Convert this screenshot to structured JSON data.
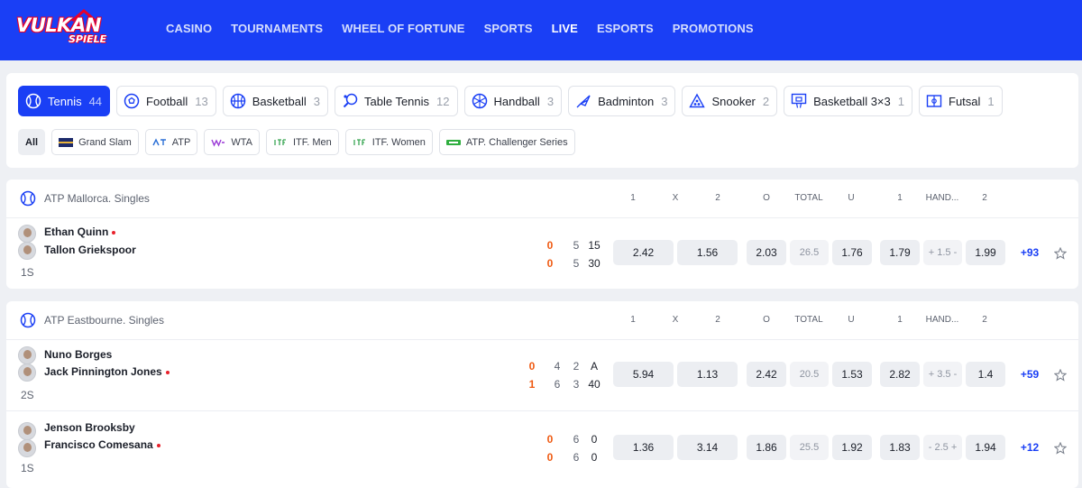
{
  "brand": {
    "logo_main": "VULKAN",
    "logo_sub": "SPIELE"
  },
  "nav": [
    {
      "label": "CASINO"
    },
    {
      "label": "TOURNAMENTS"
    },
    {
      "label": "WHEEL OF FORTUNE"
    },
    {
      "label": "SPORTS"
    },
    {
      "label": "LIVE",
      "active": true
    },
    {
      "label": "ESPORTS"
    },
    {
      "label": "PROMOTIONS"
    }
  ],
  "sports": [
    {
      "label": "Tennis",
      "count": "44",
      "icon": "tennis-ball-icon"
    },
    {
      "label": "Football",
      "count": "13",
      "icon": "football-icon"
    },
    {
      "label": "Basketball",
      "count": "3",
      "icon": "basketball-icon"
    },
    {
      "label": "Table Tennis",
      "count": "12",
      "icon": "table-tennis-icon"
    },
    {
      "label": "Handball",
      "count": "3",
      "icon": "handball-icon"
    },
    {
      "label": "Badminton",
      "count": "3",
      "icon": "shuttlecock-icon"
    },
    {
      "label": "Snooker",
      "count": "2",
      "icon": "snooker-icon"
    },
    {
      "label": "Basketball 3×3",
      "count": "1",
      "icon": "basketball-hoop-icon"
    },
    {
      "label": "Futsal",
      "count": "1",
      "icon": "futsal-icon"
    }
  ],
  "tournaments": [
    {
      "label": "All"
    },
    {
      "label": "Grand Slam",
      "icon": "grand-slam-flag-icon"
    },
    {
      "label": "ATP",
      "icon": "atp-logo-icon"
    },
    {
      "label": "WTA",
      "icon": "wta-logo-icon"
    },
    {
      "label": "ITF. Men",
      "icon": "itf-logo-icon"
    },
    {
      "label": "ITF. Women",
      "icon": "itf-logo-icon"
    },
    {
      "label": "ATP. Challenger Series",
      "icon": "challenger-logo-icon"
    }
  ],
  "columns": {
    "c1": "1",
    "cx": "X",
    "c2": "2",
    "o": "O",
    "total": "TOTAL",
    "u": "U",
    "h1": "1",
    "hand": "HAND...",
    "h2": "2"
  },
  "leagues": [
    {
      "name": "ATP Mallorca. Singles",
      "matches": [
        {
          "player1": "Ethan Quinn",
          "player2": "Tallon Griekspoor",
          "serving": 1,
          "set": "1S",
          "score": {
            "p1": [
              "0",
              "5",
              "15"
            ],
            "p2": [
              "0",
              "5",
              "30"
            ]
          },
          "odds": {
            "w1": "2.42",
            "x": "1.56",
            "o": "2.03",
            "total": "26.5",
            "u": "1.76",
            "h1": "1.79",
            "hand": "+ 1.5 -",
            "h2": "1.99"
          },
          "more": "+93"
        }
      ]
    },
    {
      "name": "ATP Eastbourne. Singles",
      "matches": [
        {
          "player1": "Nuno Borges",
          "player2": "Jack Pinnington Jones",
          "serving": 2,
          "set": "2S",
          "score": {
            "p1": [
              "0",
              "4",
              "2",
              "A"
            ],
            "p2": [
              "1",
              "6",
              "3",
              "40"
            ]
          },
          "odds": {
            "w1": "5.94",
            "x": "1.13",
            "o": "2.42",
            "total": "20.5",
            "u": "1.53",
            "h1": "2.82",
            "hand": "+ 3.5 -",
            "h2": "1.4"
          },
          "more": "+59"
        },
        {
          "player1": "Jenson Brooksby",
          "player2": "Francisco Comesana",
          "serving": 2,
          "set": "1S",
          "score": {
            "p1": [
              "0",
              "6",
              "0"
            ],
            "p2": [
              "0",
              "6",
              "0"
            ]
          },
          "odds": {
            "w1": "1.36",
            "x": "3.14",
            "o": "1.86",
            "total": "25.5",
            "u": "1.92",
            "h1": "1.83",
            "hand": "- 2.5 +",
            "h2": "1.94"
          },
          "more": "+12"
        }
      ]
    }
  ],
  "colors": {
    "brand_blue": "#1a3ff5",
    "score_orange": "#ef5a12",
    "serve_red": "#e8212b"
  }
}
